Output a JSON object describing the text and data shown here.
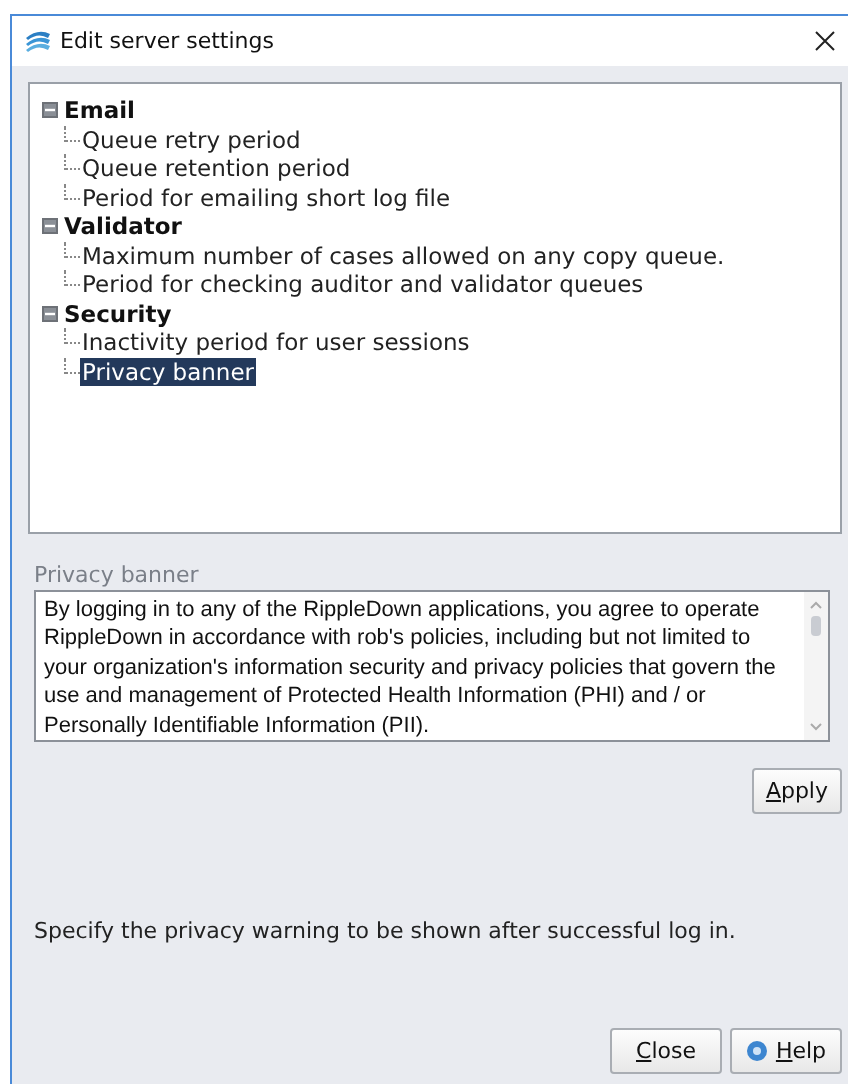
{
  "window": {
    "title": "Edit server settings"
  },
  "tree": [
    {
      "label": "Email",
      "expanded": true,
      "selected": false,
      "children": [
        {
          "label": "Queue retry period",
          "selected": false
        },
        {
          "label": "Queue retention period",
          "selected": false
        },
        {
          "label": "Period for emailing short log file",
          "selected": false
        }
      ]
    },
    {
      "label": "Validator",
      "expanded": true,
      "selected": false,
      "children": [
        {
          "label": "Maximum number of cases allowed on any copy queue.",
          "selected": false
        },
        {
          "label": "Period for checking auditor and validator queues",
          "selected": false
        }
      ]
    },
    {
      "label": "Security",
      "expanded": true,
      "selected": false,
      "children": [
        {
          "label": "Inactivity period for user sessions",
          "selected": false
        },
        {
          "label": "Privacy banner",
          "selected": true
        }
      ]
    }
  ],
  "editor": {
    "label": "Privacy banner",
    "value": "By logging in to any of the RippleDown applications, you agree to operate RippleDown in accordance with rob's policies, including but not limited to your organization's information security and privacy policies that govern the use and management of Protected Health Information (PHI) and / or Personally Identifiable Information (PII).",
    "apply_button": "Apply"
  },
  "description": "Specify the privacy warning to be shown after successful log in.",
  "buttons": [
    {
      "kind": "close",
      "label": "Close"
    },
    {
      "kind": "help",
      "label": "Help"
    }
  ]
}
